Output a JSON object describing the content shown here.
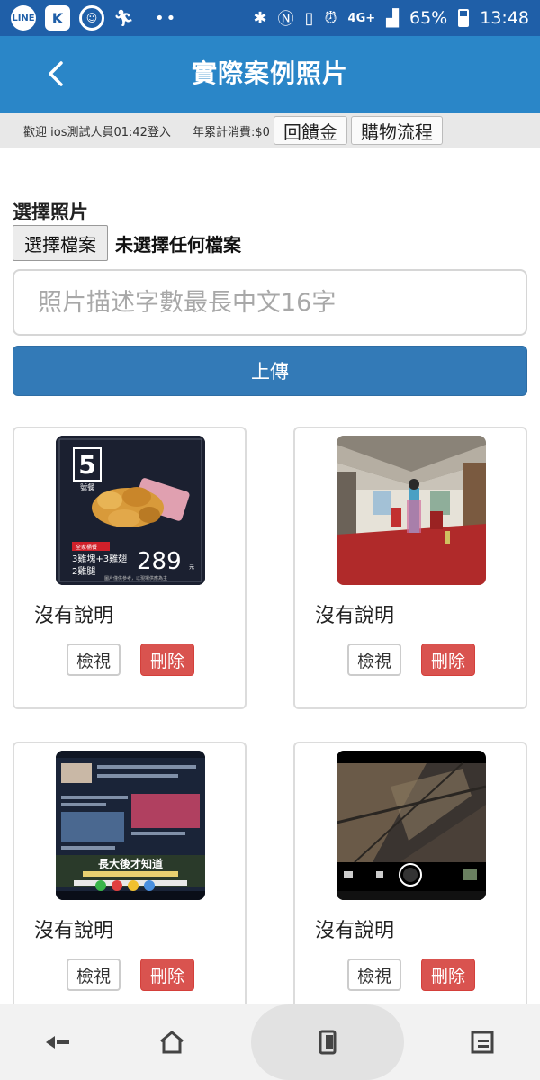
{
  "status_bar": {
    "app_icons": [
      "LINE",
      "K",
      "☺"
    ],
    "signal_text": "4G+",
    "battery": "65%",
    "time": "13:48"
  },
  "header": {
    "title": "實際案例照片"
  },
  "info_bar": {
    "welcome": "歡迎 ios測試人員01:42登入",
    "annual_spend": "年累計消費:$0",
    "rebate_button": "回饋金",
    "shopping_flow_button": "購物流程"
  },
  "form": {
    "choose_photo_label": "選擇照片",
    "choose_file_button": "選擇檔案",
    "file_status": "未選擇任何檔案",
    "description_placeholder": "照片描述字數最長中文16字",
    "upload_button": "上傳"
  },
  "photos": [
    {
      "caption": "沒有說明",
      "view_label": "檢視",
      "delete_label": "刪除",
      "thumb_text": {
        "number": "5",
        "subtitle": "號餐",
        "tag": "全家桶餐",
        "line1": "3雞塊+3雞翅",
        "line2": "2雞腿",
        "price": "289",
        "unit": "元",
        "note": "圖片僅供參考，以現場供應為主"
      }
    },
    {
      "caption": "沒有說明",
      "view_label": "檢視",
      "delete_label": "刪除"
    },
    {
      "caption": "沒有說明",
      "view_label": "檢視",
      "delete_label": "刪除",
      "thumb_text": {
        "banner": "長大後才知道"
      }
    },
    {
      "caption": "沒有說明",
      "view_label": "檢視",
      "delete_label": "刪除"
    }
  ],
  "colors": {
    "status_bar": "#1f5fa8",
    "app_bar": "#2a86c8",
    "primary_button": "#337ab7",
    "danger_button": "#d9534f"
  }
}
